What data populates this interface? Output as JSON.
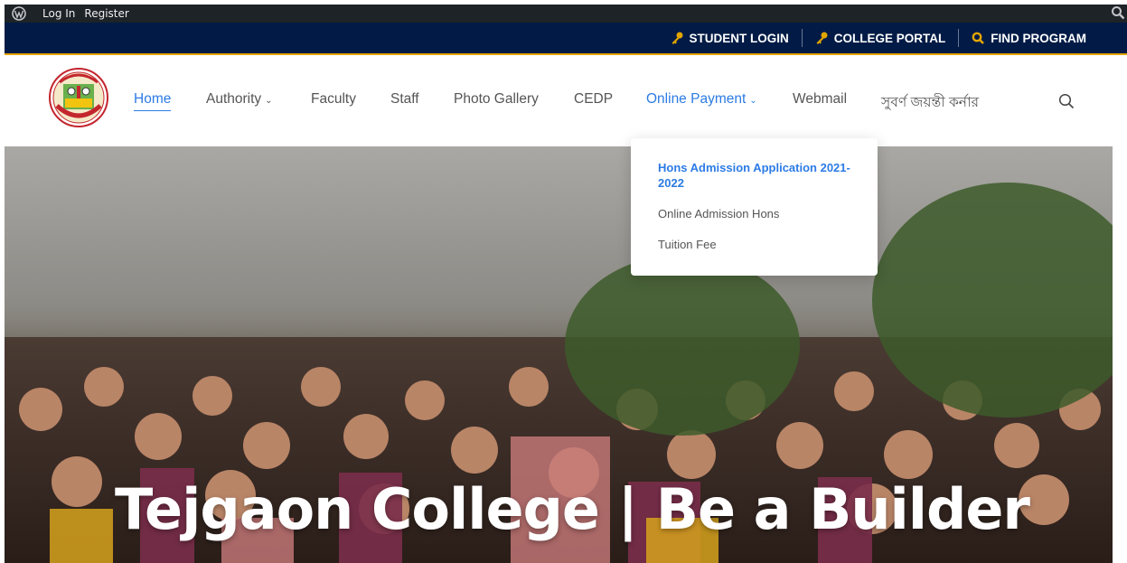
{
  "adminbar": {
    "wp_icon": "wordpress-icon",
    "login": "Log In",
    "register": "Register",
    "search_icon": "search-icon"
  },
  "topbar": {
    "links": [
      {
        "label": "STUDENT LOGIN",
        "icon": "key-icon"
      },
      {
        "label": "COLLEGE PORTAL",
        "icon": "key-icon"
      },
      {
        "label": "FIND PROGRAM",
        "icon": "search-icon"
      }
    ],
    "icon_color": "#e2a500"
  },
  "nav": {
    "items": [
      {
        "label": "Home"
      },
      {
        "label": "Authority"
      },
      {
        "label": "Faculty"
      },
      {
        "label": "Staff"
      },
      {
        "label": "Photo Gallery"
      },
      {
        "label": "CEDP"
      },
      {
        "label": "Online Payment"
      },
      {
        "label": "Webmail"
      },
      {
        "label": "সুবর্ণ জয়ন্তী কর্নার"
      }
    ],
    "search_icon": "search-icon",
    "accent": "#2c7be5"
  },
  "dropdown": {
    "items": [
      {
        "label": "Hons Admission Application 2021-2022"
      },
      {
        "label": "Online Admission Hons"
      },
      {
        "label": "Tuition Fee"
      }
    ]
  },
  "hero": {
    "title": "Tejgaon College | Be a Builder"
  }
}
